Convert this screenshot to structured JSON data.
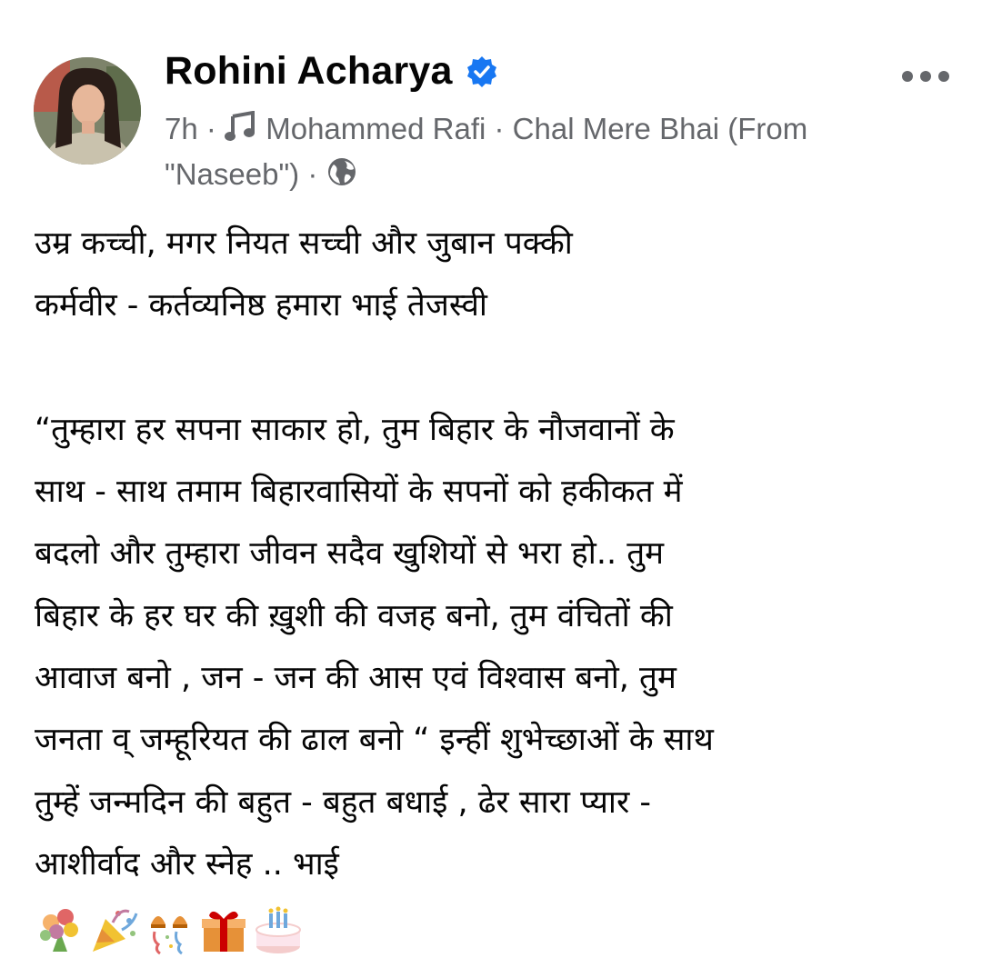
{
  "post": {
    "author": "Rohini Acharya",
    "time": "7h",
    "separator": "·",
    "music_artist": "Mohammed Rafi",
    "music_song": "Chal Mere Bhai (From \"Naseeb\")",
    "body": "उम्र कच्ची, मगर नियत सच्ची और जुबान पक्की\nकर्मवीर - कर्तव्यनिष्ठ हमारा भाई तेजस्वी\n\n“तुम्हारा हर सपना साकार हो, तुम बिहार के नौजवानों के\nसाथ - साथ तमाम बिहारवासियों के सपनों को हकीकत में\nबदलो और तुम्हारा जीवन सदैव खुशियों से भरा हो.. तुम\nबिहार के हर घर की ख़ुशी की वजह बनो, तुम वंचितों की\nआवाज बनो , जन - जन की आस एवं विश्वास बनो, तुम\nजनता व् जम्हूरियत की ढाल बनो “ इन्हीं शुभेच्छाओं के साथ\nतुम्हें जन्मदिन की बहुत - बहुत बधाई , ढेर सारा प्यार -\nआशीर्वाद और स्नेह .. भाई",
    "icons": {
      "verified": "verified-badge-icon",
      "music": "music-note-icon",
      "privacy": "globe-icon",
      "more": "more-options-icon"
    },
    "emojis": [
      "bouquet",
      "party-popper",
      "confetti-ball",
      "gift",
      "birthday-cake"
    ]
  },
  "colors": {
    "verified_blue": "#1877f2",
    "meta_gray": "#65676b",
    "text": "#050505"
  }
}
